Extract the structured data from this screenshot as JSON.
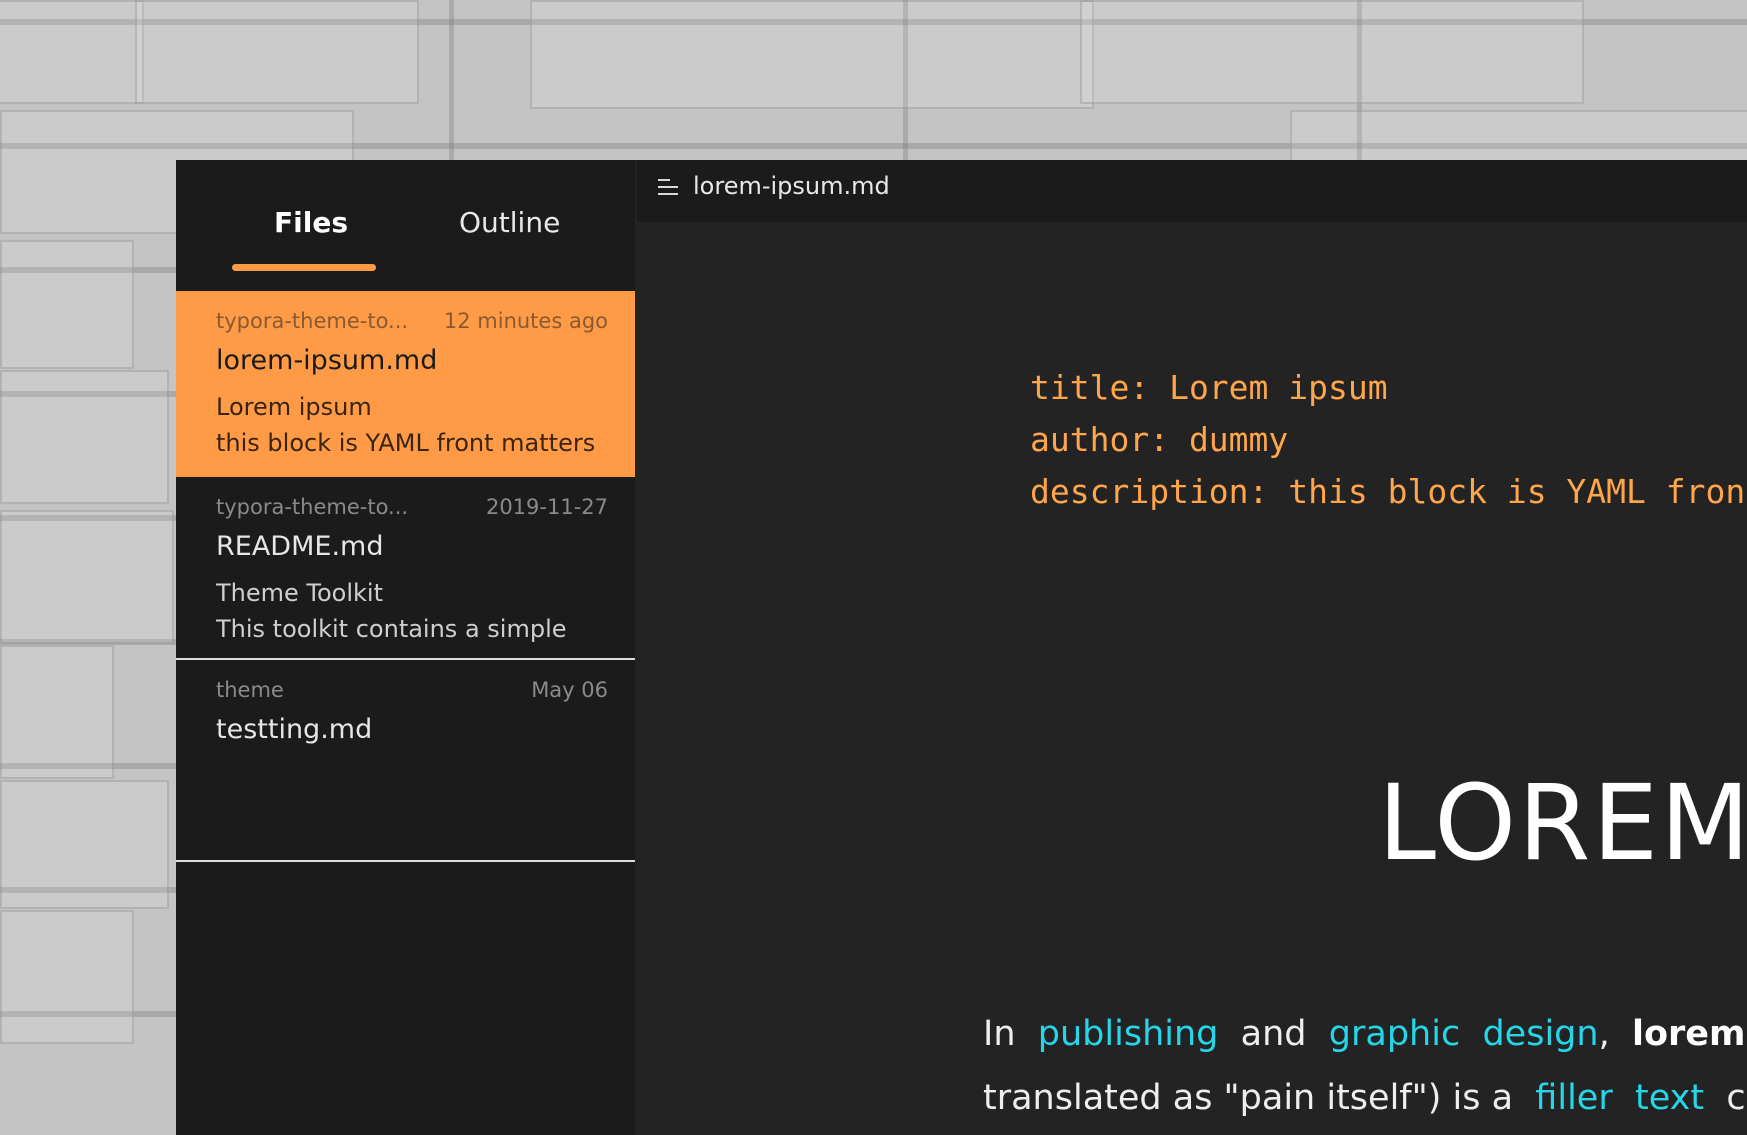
{
  "sidebar": {
    "tabs": [
      {
        "label": "Files"
      },
      {
        "label": "Outline"
      }
    ],
    "files": [
      {
        "folder": "typora-theme-to...",
        "time": "12 minutes ago",
        "name_base": "lorem-ipsum",
        "name_ext": ".md",
        "preview": "Lorem ipsum\nthis block is YAML front matters"
      },
      {
        "folder": "typora-theme-to...",
        "time": "2019-11-27",
        "name_base": "README",
        "name_ext": ".md",
        "preview": "Theme Toolkit\nThis toolkit contains a simple"
      },
      {
        "folder": "theme",
        "time": "May 06",
        "name_base": "testting",
        "name_ext": ".md",
        "preview": ""
      }
    ]
  },
  "titlebar": {
    "filename": "lorem-ipsum.md"
  },
  "editor": {
    "yaml_lines": [
      "title: Lorem ipsum",
      "author: dummy",
      "description: this block is YAML front m"
    ],
    "heading": "LOREM",
    "paragraph": {
      "line1": {
        "w1": "In",
        "link1": "publishing",
        "w2": "and",
        "link2": "graphic",
        "link3": "design",
        "w3": ",",
        "bold": "lorem ip"
      },
      "line2": {
        "w1": "translated as \"pain itself\") is a",
        "link1": "filler",
        "link2": "text",
        "w2": "com"
      }
    }
  },
  "colors": {
    "accent": "#ff9b47",
    "link": "#25d6e8",
    "yaml": "#ffa54a"
  }
}
